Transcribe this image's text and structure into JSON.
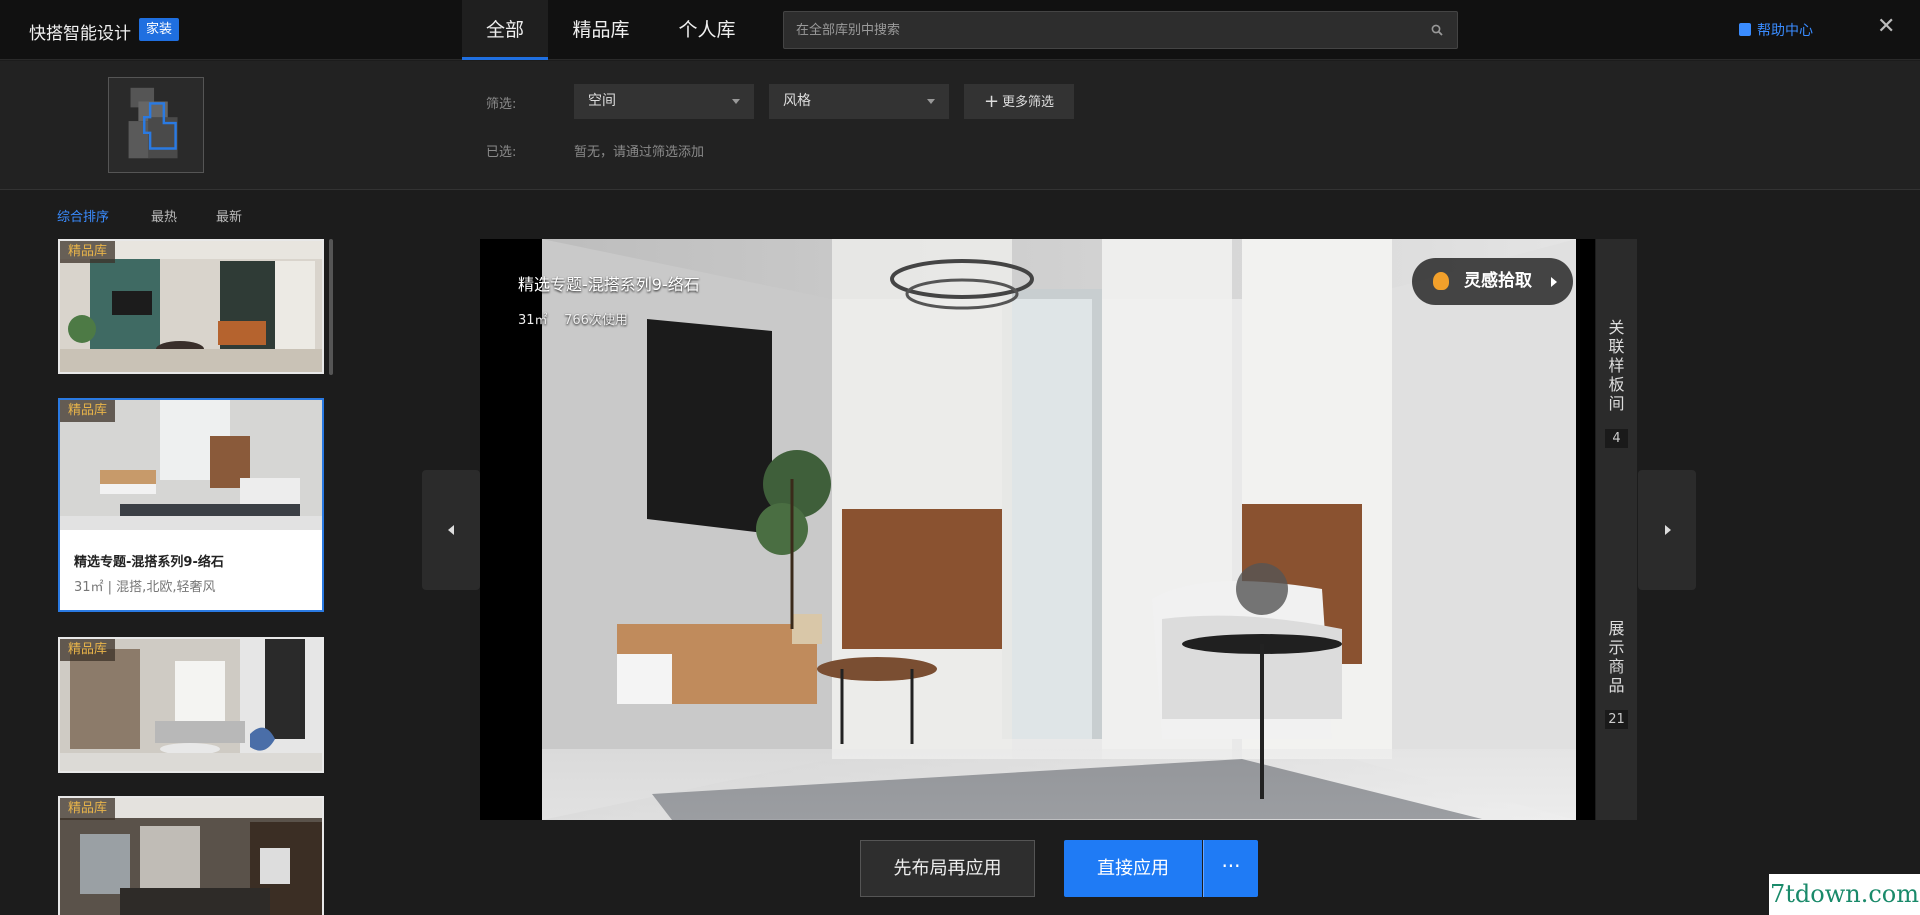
{
  "app": {
    "title": "快搭智能设计",
    "badge": "家装"
  },
  "tabs": [
    {
      "label": "全部"
    },
    {
      "label": "精品库"
    },
    {
      "label": "个人库"
    }
  ],
  "search": {
    "placeholder": "在全部库别中搜索"
  },
  "help": {
    "label": "帮助中心"
  },
  "close": {
    "label": "✕"
  },
  "filters": {
    "filter_label": "筛选:",
    "selected_label": "已选:",
    "space": "空间",
    "style": "风格",
    "more": "更多筛选",
    "selected_hint": "暂无，请通过筛选添加"
  },
  "sort": [
    {
      "label": "综合排序"
    },
    {
      "label": "最热"
    },
    {
      "label": "最新"
    }
  ],
  "list": [
    {
      "tag": "精品库"
    },
    {
      "tag": "精品库",
      "title": "精选专题-混搭系列9-络石",
      "meta": "31㎡ | 混搭,北欧,轻奢风"
    },
    {
      "tag": "精品库"
    },
    {
      "tag": "精品库"
    }
  ],
  "preview": {
    "title": "精选专题-混搭系列9-络石",
    "area": "31㎡",
    "uses": "766次使用",
    "inspiration": "灵感拾取"
  },
  "side": {
    "related_label": "关联样板间",
    "related_count": "4",
    "products_label": "展示商品",
    "products_count": "21"
  },
  "actions": {
    "layout_first": "先布局再应用",
    "apply": "直接应用",
    "more": "···"
  },
  "watermark": "7tdown.com"
}
